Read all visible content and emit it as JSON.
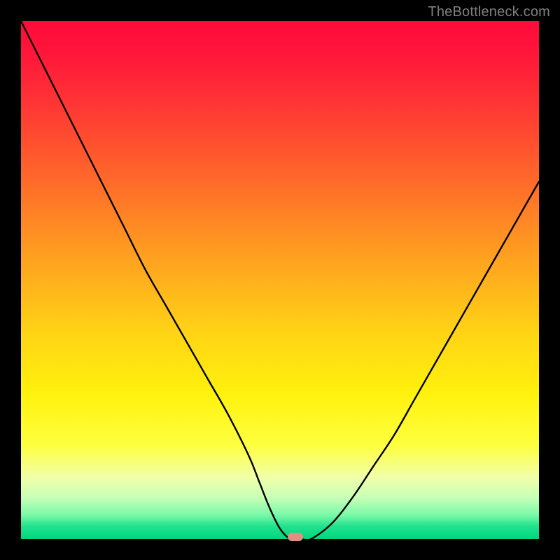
{
  "watermark": "TheBottleneck.com",
  "colors": {
    "frame": "#000000",
    "curve": "#000000",
    "marker": "#e38e81",
    "watermark": "#7f7f7f",
    "gradient_top": "#ff0b3b",
    "gradient_bottom": "#00d67f"
  },
  "chart_data": {
    "type": "line",
    "title": "",
    "xlabel": "",
    "ylabel": "",
    "xlim": [
      0,
      100
    ],
    "ylim": [
      0,
      100
    ],
    "grid": false,
    "legend": false,
    "x": [
      0,
      4,
      8,
      12,
      16,
      20,
      24,
      28,
      32,
      36,
      40,
      44,
      46,
      48,
      50,
      52,
      54,
      56,
      60,
      64,
      68,
      72,
      76,
      80,
      84,
      88,
      92,
      96,
      100
    ],
    "values": [
      100,
      92,
      84,
      76,
      68,
      60,
      52,
      45,
      38,
      31,
      24,
      16,
      11,
      6,
      2,
      0,
      0,
      0,
      3,
      8,
      14,
      20,
      27,
      34,
      41,
      48,
      55,
      62,
      69
    ],
    "marker": {
      "x": 53,
      "y": 0
    },
    "notes": "V-shaped bottleneck curve over vertical red-to-green gradient. Values approximate; no axis ticks or labels are visible."
  }
}
